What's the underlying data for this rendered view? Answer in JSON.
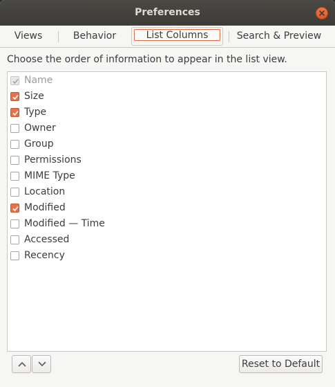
{
  "window": {
    "title": "Preferences"
  },
  "tabs": [
    {
      "label": "Views"
    },
    {
      "label": "Behavior"
    },
    {
      "label": "List Columns"
    },
    {
      "label": "Search & Preview"
    }
  ],
  "description": "Choose the order of information to appear in the list view.",
  "columns": [
    {
      "label": "Name",
      "checked": true,
      "disabled": true
    },
    {
      "label": "Size",
      "checked": true,
      "disabled": false
    },
    {
      "label": "Type",
      "checked": true,
      "disabled": false
    },
    {
      "label": "Owner",
      "checked": false,
      "disabled": false
    },
    {
      "label": "Group",
      "checked": false,
      "disabled": false
    },
    {
      "label": "Permissions",
      "checked": false,
      "disabled": false
    },
    {
      "label": "MIME Type",
      "checked": false,
      "disabled": false
    },
    {
      "label": "Location",
      "checked": false,
      "disabled": false
    },
    {
      "label": "Modified",
      "checked": true,
      "disabled": false
    },
    {
      "label": "Modified — Time",
      "checked": false,
      "disabled": false
    },
    {
      "label": "Accessed",
      "checked": false,
      "disabled": false
    },
    {
      "label": "Recency",
      "checked": false,
      "disabled": false
    }
  ],
  "buttons": {
    "move_up_icon": "chevron-up-icon",
    "move_down_icon": "chevron-down-icon",
    "reset_label": "Reset to Default"
  },
  "colors": {
    "accent": "#e2734a",
    "titlebar": "#3c3b37"
  }
}
